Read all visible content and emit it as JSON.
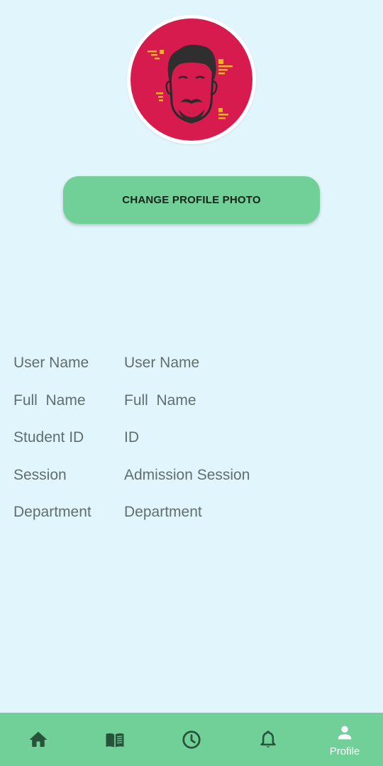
{
  "profile": {
    "change_photo_label": "CHANGE PROFILE PHOTO",
    "avatar_icon": "bearded-man-avatar-icon"
  },
  "info": [
    {
      "label": "User Name",
      "value": "User Name"
    },
    {
      "label": "Full  Name",
      "value": "Full  Name"
    },
    {
      "label": "Student ID",
      "value": "ID"
    },
    {
      "label": "Session",
      "value": "Admission Session"
    },
    {
      "label": "Department",
      "value": "Department"
    }
  ],
  "bottom_nav": {
    "items": [
      {
        "icon": "home-icon",
        "label": ""
      },
      {
        "icon": "book-icon",
        "label": ""
      },
      {
        "icon": "clock-icon",
        "label": ""
      },
      {
        "icon": "bell-icon",
        "label": ""
      },
      {
        "icon": "person-icon",
        "label": "Profile"
      }
    ],
    "active_index": 4
  },
  "colors": {
    "background": "#e1f5fc",
    "accent": "#70d097",
    "avatar_bg": "#d81b4e",
    "text_muted": "#5f6f6e",
    "icon_dark": "#265339"
  }
}
